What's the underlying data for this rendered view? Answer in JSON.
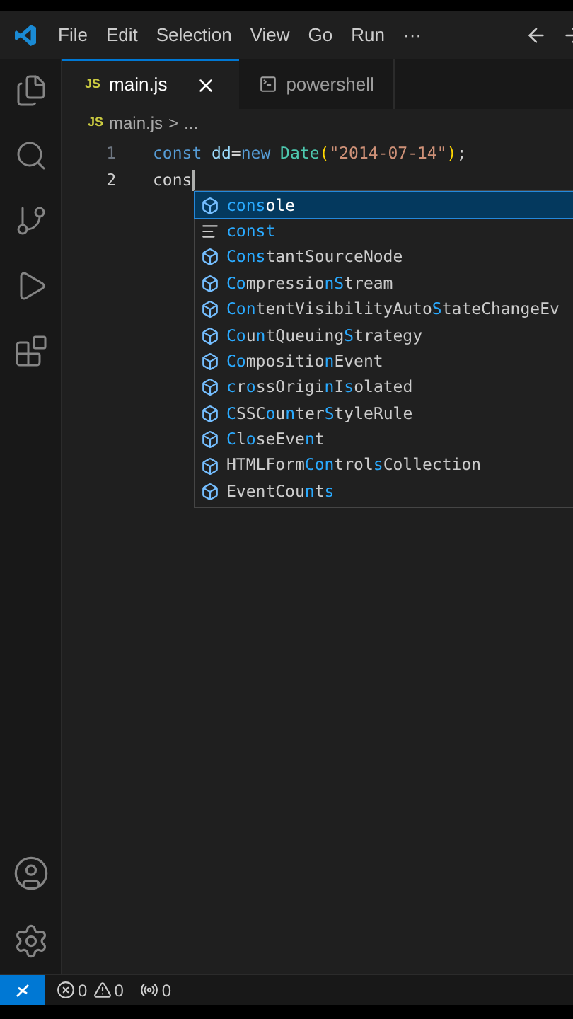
{
  "menu": {
    "items": [
      "File",
      "Edit",
      "Selection",
      "View",
      "Go",
      "Run",
      "···"
    ]
  },
  "tabs": [
    {
      "badge": "JS",
      "label": "main.js",
      "selected": true,
      "kind": "file"
    },
    {
      "label": "powershell",
      "selected": false,
      "kind": "terminal"
    }
  ],
  "breadcrumb": {
    "badge": "JS",
    "file": "main.js",
    "separator": ">",
    "rest": "..."
  },
  "editor": {
    "lines": [
      {
        "number": "1",
        "tokens": [
          {
            "kind": "keyword",
            "text": "const "
          },
          {
            "kind": "variable",
            "text": "dd"
          },
          {
            "kind": "plain",
            "text": "="
          },
          {
            "kind": "keyword",
            "text": "new "
          },
          {
            "kind": "type",
            "text": "Date"
          },
          {
            "kind": "bracket",
            "text": "("
          },
          {
            "kind": "string",
            "text": "\"2014-07-14\""
          },
          {
            "kind": "bracket",
            "text": ")"
          },
          {
            "kind": "plain",
            "text": ";"
          }
        ]
      },
      {
        "number": "2",
        "tokens": [
          {
            "kind": "plain",
            "text": "cons"
          }
        ],
        "cursor": true
      }
    ]
  },
  "suggestions": [
    {
      "kind": "variable",
      "label": "**cons**ole",
      "selected": true
    },
    {
      "kind": "keyword",
      "label": "**const**",
      "selected": false
    },
    {
      "kind": "variable",
      "label": "**Cons**tantSourceNode",
      "selected": false
    },
    {
      "kind": "variable",
      "label": "**Co**mpressio**nS**tream",
      "selected": false
    },
    {
      "kind": "variable",
      "label": "**Con**tentVisibilityAuto**S**tateChangeEv",
      "selected": false
    },
    {
      "kind": "variable",
      "label": "**Co**u**n**tQueuing**S**trategy",
      "selected": false
    },
    {
      "kind": "variable",
      "label": "**Co**mpositio**n**Event",
      "selected": false
    },
    {
      "kind": "variable",
      "label": "**c**r**o**ssOrigi**n**I**s**olated",
      "selected": false
    },
    {
      "kind": "variable",
      "label": "**C**SSC**o**u**n**ter**S**tyleRule",
      "selected": false
    },
    {
      "kind": "variable",
      "label": "**C**l**o**seEve**n**t",
      "selected": false
    },
    {
      "kind": "variable",
      "label": "HTMLForm**Con**trol**s**Collection",
      "selected": false
    },
    {
      "kind": "variable",
      "label": "EventCou**n**t**s**",
      "selected": false
    }
  ],
  "status_bar": {
    "errors": "0",
    "warnings": "0",
    "ports": "0"
  }
}
